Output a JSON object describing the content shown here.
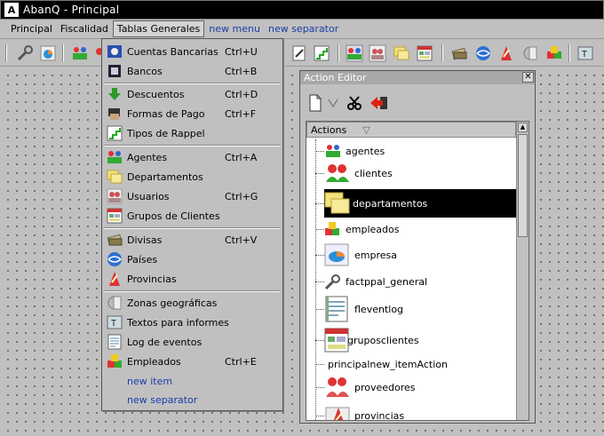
{
  "window": {
    "title": "AbanQ - Principal"
  },
  "menubar": {
    "items": [
      {
        "label": "Principal"
      },
      {
        "label": "Fiscalidad"
      },
      {
        "label": "Tablas Generales"
      },
      {
        "label": "new menu"
      },
      {
        "label": "new separator"
      }
    ]
  },
  "dropdown": {
    "items": [
      {
        "label": "Cuentas Bancarias",
        "shortcut": "Ctrl+U"
      },
      {
        "label": "Bancos",
        "shortcut": "Ctrl+B"
      },
      {
        "label": "Descuentos",
        "shortcut": "Ctrl+D"
      },
      {
        "label": "Formas de Pago",
        "shortcut": "Ctrl+F"
      },
      {
        "label": "Tipos de Rappel",
        "shortcut": ""
      },
      {
        "label": "Agentes",
        "shortcut": "Ctrl+A"
      },
      {
        "label": "Departamentos",
        "shortcut": ""
      },
      {
        "label": "Usuarios",
        "shortcut": "Ctrl+G"
      },
      {
        "label": "Grupos de Clientes",
        "shortcut": ""
      },
      {
        "label": "Divisas",
        "shortcut": "Ctrl+V"
      },
      {
        "label": "Países",
        "shortcut": ""
      },
      {
        "label": "Provincias",
        "shortcut": ""
      },
      {
        "label": "Zonas geográficas",
        "shortcut": ""
      },
      {
        "label": "Textos para informes",
        "shortcut": ""
      },
      {
        "label": "Log de eventos",
        "shortcut": ""
      },
      {
        "label": "Empleados",
        "shortcut": "Ctrl+E"
      },
      {
        "label": "new item",
        "shortcut": ""
      },
      {
        "label": "new separator",
        "shortcut": ""
      }
    ]
  },
  "action_editor": {
    "title": "Action Editor",
    "close": "✕",
    "column_header": "Actions",
    "actions": [
      {
        "label": "agentes"
      },
      {
        "label": "clientes"
      },
      {
        "label": "departamentos"
      },
      {
        "label": "empleados"
      },
      {
        "label": "empresa"
      },
      {
        "label": "factppal_general"
      },
      {
        "label": "fleventlog"
      },
      {
        "label": "gruposclientes"
      },
      {
        "label": "principalnew_itemAction"
      },
      {
        "label": "proveedores"
      },
      {
        "label": "provincias"
      }
    ]
  },
  "colors": {
    "title_bar": "#000000",
    "selection": "#000000",
    "link_blue": "#1b3ea8"
  }
}
